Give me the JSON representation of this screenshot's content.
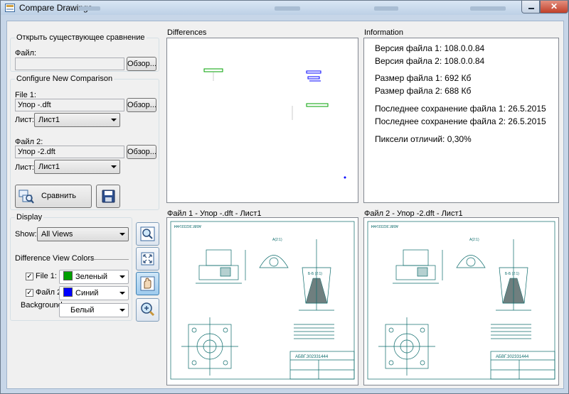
{
  "window": {
    "title": "Compare Drawings",
    "close_glyph": "✕"
  },
  "open_existing": {
    "group_title": "Открыть существующее сравнение",
    "file_label": "Файл:",
    "file_value": "",
    "browse_label": "Обзор..."
  },
  "configure": {
    "group_title": "Configure New Comparison",
    "file1_label": "File 1:",
    "file1_value": "Упор -.dft",
    "browse1_label": "Обзор...",
    "sheet1_label": "Лист:",
    "sheet1_value": "Лист1",
    "file2_label": "Файл 2:",
    "file2_value": "Упор -2.dft",
    "browse2_label": "Обзор...",
    "sheet2_label": "Лист:",
    "sheet2_value": "Лист1",
    "compare_label": "Сравнить"
  },
  "display": {
    "group_title": "Display",
    "show_label": "Show:",
    "show_value": "All Views",
    "colors_title": "Difference View Colors",
    "file1_label": "File 1:",
    "file1_checked": true,
    "file1_color_name": "Зеленый",
    "file1_color": "#00a000",
    "file2_label": "Файл 2:",
    "file2_checked": true,
    "file2_color_name": "Синий",
    "file2_color": "#0000ff",
    "background_label": "Background:",
    "background_value": "Белый"
  },
  "panels": {
    "differences_title": "Differences",
    "information_title": "Information",
    "file1_view_title": "Файл 1 - Упор -.dft - Лист1",
    "file2_view_title": "Файл 2 - Упор -2.dft - Лист1"
  },
  "information": {
    "version1": "Версия файла 1: 108.0.0.84",
    "version2": "Версия файла 2: 108.0.0.84",
    "size1": "Размер файла 1: 692 Кб",
    "size2": "Размер файла 2: 688 Кб",
    "saved1": "Последнее сохранение файла 1: 26.5.2015",
    "saved2": "Последнее сохранение файла 2: 26.5.2015",
    "pixels": "Пиксели отличий: 0,30%"
  },
  "drawing": {
    "stamp_text": "АБВГ.302331444",
    "section_label": "Б-Б (2:1)",
    "view_label": "А(2:1)"
  },
  "colors": {
    "accent": "#3c7fb1",
    "drawing_line": "#0a6a6a",
    "diff_green": "#00a000",
    "diff_blue": "#0000ff"
  }
}
